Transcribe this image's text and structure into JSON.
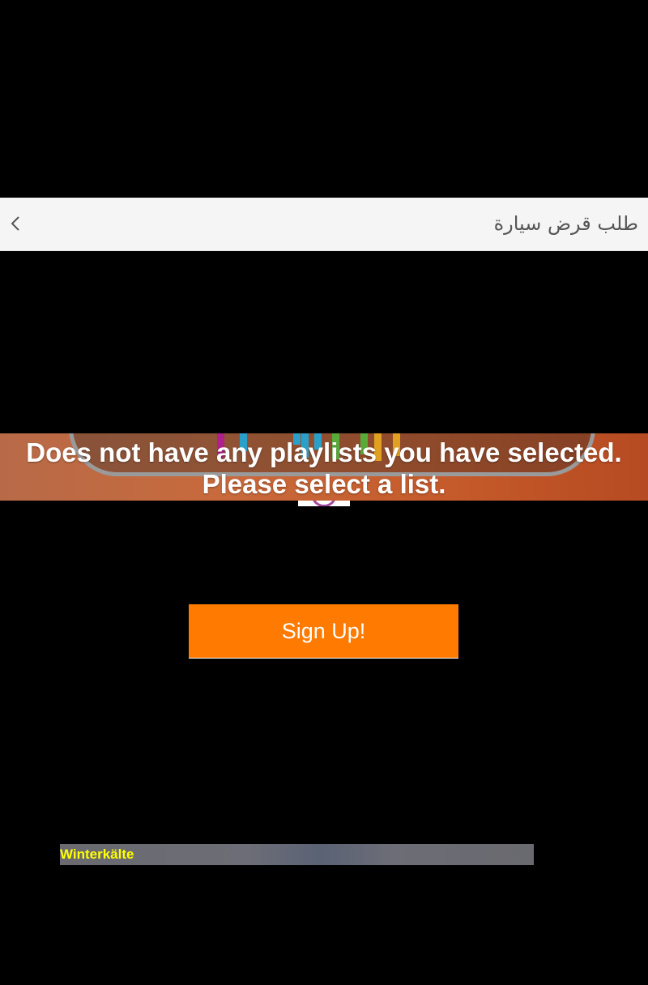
{
  "header": {
    "title": "طلب قرض سيارة",
    "back_icon": "chevron-left-icon"
  },
  "banner": {
    "message": "Does not have any playlists you have selected. Please select a list."
  },
  "signup": {
    "label": "Sign Up!"
  },
  "track": {
    "title": "Winterkälte"
  },
  "colors": {
    "header_bg": "#f5f5f5",
    "accent": "#ff7a00",
    "track_text": "#ffff00",
    "banner_bg": "#c55a2a"
  }
}
